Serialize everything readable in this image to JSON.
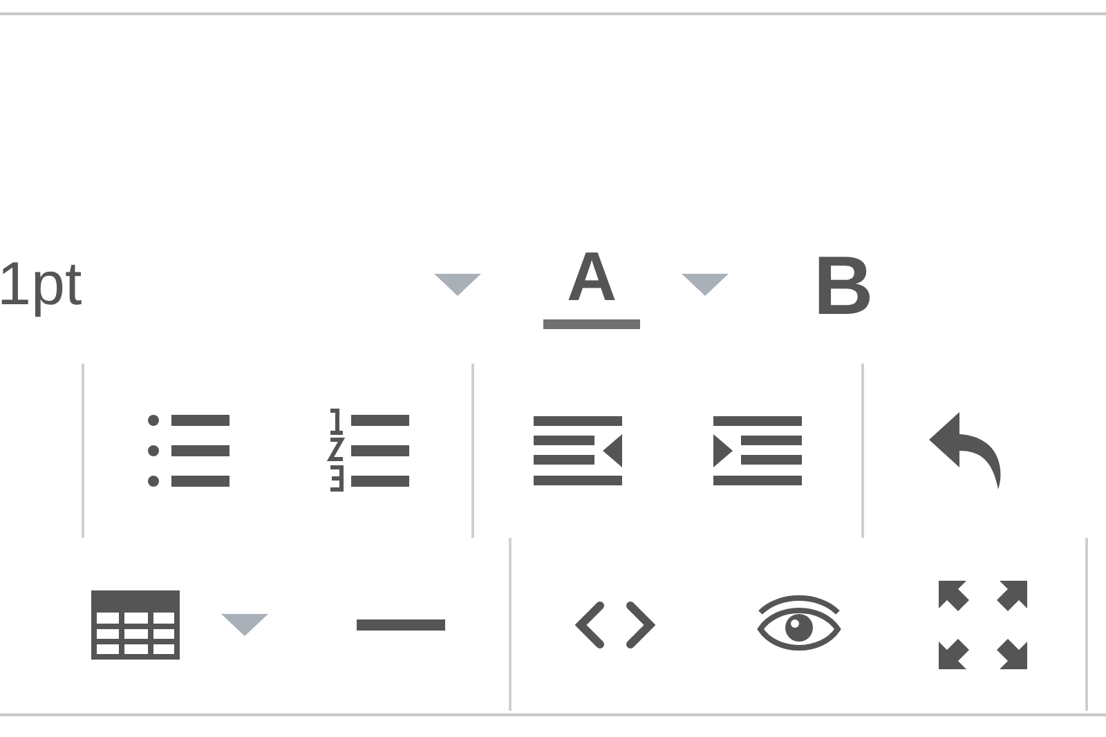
{
  "font_size_select": {
    "value": "1pt"
  },
  "toolbar_rows": [
    [
      {
        "kind": "font-color",
        "label": "A",
        "dropdown": true
      },
      {
        "kind": "bold",
        "label": "B",
        "dropdown": false
      }
    ],
    [
      {
        "kind": "separator"
      },
      {
        "kind": "bullet-list",
        "dropdown": false
      },
      {
        "kind": "numbered-list",
        "dropdown": false
      },
      {
        "kind": "separator"
      },
      {
        "kind": "outdent",
        "dropdown": false
      },
      {
        "kind": "indent",
        "dropdown": false
      },
      {
        "kind": "separator"
      },
      {
        "kind": "undo",
        "dropdown": false
      }
    ],
    [
      {
        "kind": "table",
        "dropdown": true
      },
      {
        "kind": "horizontal-rule",
        "dropdown": false
      },
      {
        "kind": "separator"
      },
      {
        "kind": "code",
        "dropdown": false
      },
      {
        "kind": "preview",
        "dropdown": false
      },
      {
        "kind": "fullscreen",
        "dropdown": false
      },
      {
        "kind": "separator"
      }
    ]
  ]
}
